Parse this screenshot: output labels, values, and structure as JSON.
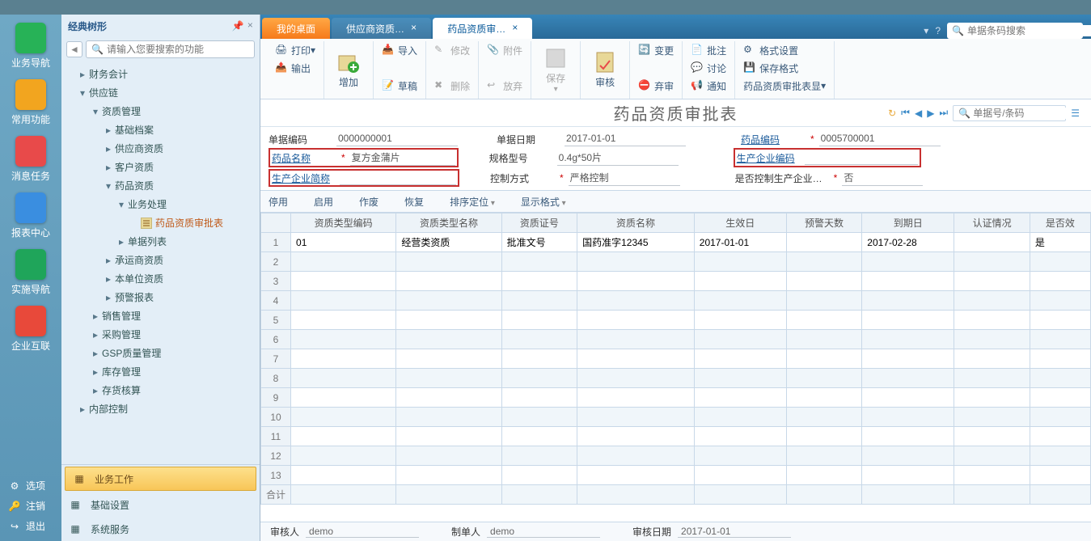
{
  "rail": [
    {
      "label": "业务导航",
      "color": "#27b257"
    },
    {
      "label": "常用功能",
      "color": "#f2a51f"
    },
    {
      "label": "消息任务",
      "color": "#e84a4a"
    },
    {
      "label": "报表中心",
      "color": "#3a8ee0"
    },
    {
      "label": "实施导航",
      "color": "#1fa55a"
    },
    {
      "label": "企业互联",
      "color": "#e8493a"
    }
  ],
  "railBottom": [
    {
      "label": "选项",
      "ico": "gear"
    },
    {
      "label": "注销",
      "ico": "key"
    },
    {
      "label": "退出",
      "ico": "exit"
    }
  ],
  "treeTitle": "经典树形",
  "searchPlaceholder": "请输入您要搜索的功能",
  "tree": [
    {
      "t": "财务会计",
      "lv": 1,
      "exp": false
    },
    {
      "t": "供应链",
      "lv": 1,
      "exp": true
    },
    {
      "t": "资质管理",
      "lv": 2,
      "exp": true
    },
    {
      "t": "基础档案",
      "lv": 3,
      "exp": false
    },
    {
      "t": "供应商资质",
      "lv": 3,
      "exp": false
    },
    {
      "t": "客户资质",
      "lv": 3,
      "exp": false
    },
    {
      "t": "药品资质",
      "lv": 3,
      "exp": true
    },
    {
      "t": "业务处理",
      "lv": 4,
      "exp": true
    },
    {
      "t": "药品资质审批表",
      "lv": 5,
      "file": true,
      "active": true
    },
    {
      "t": "单据列表",
      "lv": 4,
      "exp": false
    },
    {
      "t": "承运商资质",
      "lv": 3,
      "exp": false
    },
    {
      "t": "本单位资质",
      "lv": 3,
      "exp": false
    },
    {
      "t": "预警报表",
      "lv": 3,
      "exp": false
    },
    {
      "t": "销售管理",
      "lv": 2,
      "exp": false
    },
    {
      "t": "采购管理",
      "lv": 2,
      "exp": false
    },
    {
      "t": "GSP质量管理",
      "lv": 2,
      "exp": false
    },
    {
      "t": "库存管理",
      "lv": 2,
      "exp": false
    },
    {
      "t": "存货核算",
      "lv": 2,
      "exp": false
    },
    {
      "t": "内部控制",
      "lv": 1,
      "exp": false
    }
  ],
  "treeFooter": [
    {
      "label": "业务工作",
      "active": true
    },
    {
      "label": "基础设置"
    },
    {
      "label": "系统服务"
    }
  ],
  "tabs": [
    {
      "label": "我的桌面",
      "type": "orange"
    },
    {
      "label": "供应商资质…",
      "close": true
    },
    {
      "label": "药品资质审…",
      "active": true,
      "close": true
    }
  ],
  "topSearchPlaceholder": "单据条码搜索",
  "ribbon": {
    "print": "打印",
    "export": "输出",
    "add": "增加",
    "import": "导入",
    "draft": "草稿",
    "edit": "修改",
    "delete": "删除",
    "attach": "附件",
    "discard": "放弃",
    "save": "保存",
    "audit": "审核",
    "annot": "批注",
    "discuss": "讨论",
    "notify": "通知",
    "change": "变更",
    "abandon": "弃审",
    "fmt": "格式设置",
    "savefmt": "保存格式",
    "displayfmt": "药品资质审批表显"
  },
  "pageTitle": "药品资质审批表",
  "navSearchPlaceholder": "单据号/条码",
  "form": {
    "f1l": "单据编码",
    "f1v": "0000000001",
    "f2l": "单据日期",
    "f2v": "2017-01-01",
    "f3l": "药品编码",
    "f3v": "0005700001",
    "f4l": "药品名称",
    "f4v": "复方金蒲片",
    "f5l": "规格型号",
    "f5v": "0.4g*50片",
    "f6l": "生产企业编码",
    "f6v": "",
    "f7l": "生产企业简称",
    "f7v": "",
    "f8l": "控制方式",
    "f8v": "严格控制",
    "f9l": "是否控制生产企业…",
    "f9v": "否"
  },
  "gridToolbar": [
    "停用",
    "启用",
    "作废",
    "恢复"
  ],
  "gridToolbarDD": [
    "排序定位",
    "显示格式"
  ],
  "gridCols": [
    "资质类型编码",
    "资质类型名称",
    "资质证号",
    "资质名称",
    "生效日",
    "预警天数",
    "到期日",
    "认证情况",
    "是否效"
  ],
  "gridRows": [
    {
      "c": [
        "01",
        "经营类资质",
        "批准文号",
        "国药准字12345",
        "2017-01-01",
        "",
        "2017-02-28",
        "",
        "是"
      ]
    }
  ],
  "gridBlankRows": 12,
  "gridTotalLabel": "合计",
  "footer": {
    "f1l": "审核人",
    "f1v": "demo",
    "f2l": "制单人",
    "f2v": "demo",
    "f3l": "审核日期",
    "f3v": "2017-01-01"
  }
}
